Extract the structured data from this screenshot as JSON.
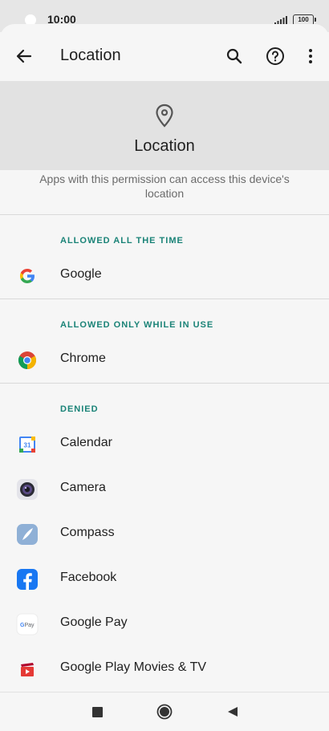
{
  "status_bar": {
    "time": "10:00",
    "battery": "100"
  },
  "top_bar": {
    "title": "Location"
  },
  "hero": {
    "title": "Location"
  },
  "description": "Apps with this permission can access this device's location",
  "sections": [
    {
      "header": "ALLOWED ALL THE TIME",
      "apps": [
        "Google"
      ]
    },
    {
      "header": "ALLOWED ONLY WHILE IN USE",
      "apps": [
        "Chrome"
      ]
    },
    {
      "header": "DENIED",
      "apps": [
        "Calendar",
        "Camera",
        "Compass",
        "Facebook",
        "Google Pay",
        "Google Play Movies & TV"
      ]
    }
  ],
  "icons": {
    "back": "arrow-back-icon",
    "search": "search-icon",
    "help": "help-icon",
    "more": "more-vert-icon",
    "location": "location-pin-icon"
  },
  "colors": {
    "accent": "#1a8377",
    "hero_bg": "#e2e2e2",
    "background": "#f6f6f6"
  }
}
